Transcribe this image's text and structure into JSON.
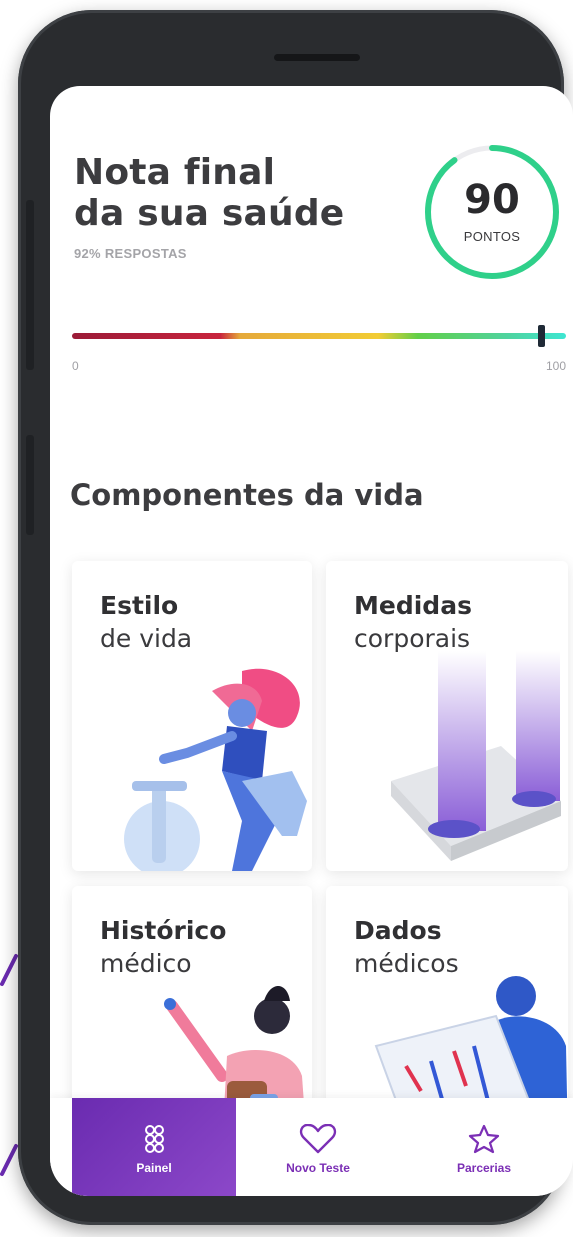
{
  "header": {
    "title_line1": "Nota final",
    "title_line2": "da sua saúde",
    "subtitle": "92% RESPOSTAS"
  },
  "score": {
    "value": "90",
    "unit": "PONTOS",
    "progress": 0.9,
    "ring_color": "#2fd08a"
  },
  "scale": {
    "min": "0",
    "max": "100",
    "marker_value": 95
  },
  "section": {
    "title": "Componentes da vida"
  },
  "cards": [
    {
      "title": "Estilo",
      "subtitle": "de vida",
      "icon": "cyclist-illustration"
    },
    {
      "title": "Medidas",
      "subtitle": "corporais",
      "icon": "scale-illustration"
    },
    {
      "title": "Histórico",
      "subtitle": "médico",
      "icon": "doctor-illustration"
    },
    {
      "title": "Dados",
      "subtitle": "médicos",
      "icon": "chart-illustration"
    }
  ],
  "nav": {
    "items": [
      {
        "label": "Painel",
        "icon": "dashboard-icon",
        "active": true
      },
      {
        "label": "Novo Teste",
        "icon": "heart-icon",
        "active": false
      },
      {
        "label": "Parcerias",
        "icon": "star-icon",
        "active": false
      }
    ]
  },
  "colors": {
    "accent": "#7b2fb5",
    "text": "#3c3c3f"
  }
}
